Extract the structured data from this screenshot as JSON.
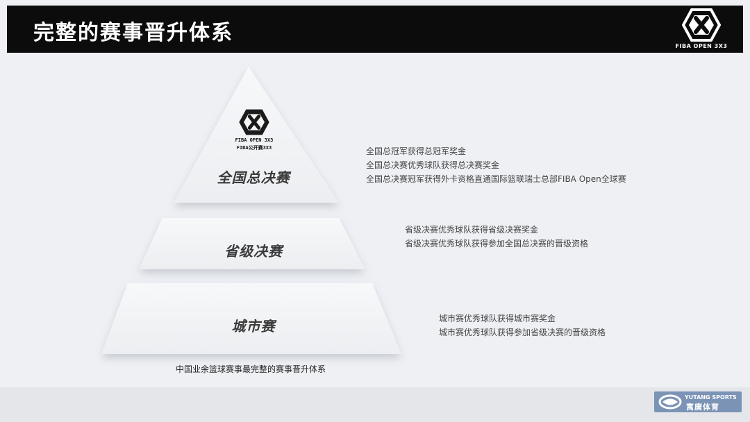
{
  "header": {
    "title": "完整的赛事晋升体系",
    "logo_icon": "fiba-3x3-logo-icon",
    "logo_text": "FIBA OPEN 3X3"
  },
  "pyramid": {
    "apex_logo": {
      "icon": "fiba-3x3-logo-icon",
      "line1": "FIBA OPEN 3X3",
      "line2": "FIBA公开赛3X3"
    },
    "tiers": [
      {
        "label": "全国总决赛",
        "descriptions": [
          "全国总冠军获得总冠军奖金",
          "全国总决赛优秀球队获得总决赛奖金",
          "全国总决赛冠军获得外卡资格直通国际篮联瑞士总部FIBA Open全球赛"
        ]
      },
      {
        "label": "省级决赛",
        "descriptions": [
          "省级决赛优秀球队获得省级决赛奖金",
          "省级决赛优秀球队获得参加全国总决赛的晋级资格"
        ]
      },
      {
        "label": "城市赛",
        "descriptions": [
          "城市赛优秀球队获得城市赛奖金",
          "城市赛优秀球队获得参加省级决赛的晋级资格"
        ]
      }
    ],
    "caption": "中国业余篮球赛事最完整的赛事晋升体系"
  },
  "brand": {
    "icon": "yutang-sports-logo-icon",
    "name_en": "YUTANG SPORTS",
    "name_cn": "寓唐体育"
  },
  "colors": {
    "header_bg": "#0c0c0c",
    "page_bg": "#eef0f4",
    "tier_fill": "#f3f4f6",
    "badge_bg": "#7b93b5"
  }
}
